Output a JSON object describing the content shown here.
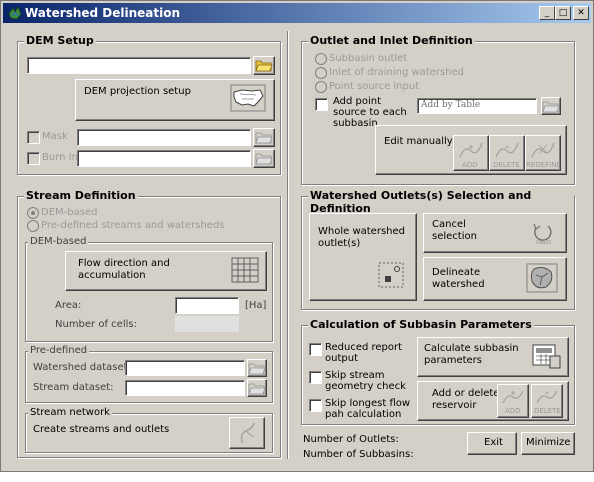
{
  "window": {
    "title": "Watershed Delineation",
    "minimize": "_",
    "restore": "□",
    "close": "✕"
  },
  "dem_setup": {
    "title": "DEM Setup",
    "projection_button": "DEM projection setup",
    "mask_label": "Mask",
    "burn_in_label": "Burn In"
  },
  "stream_definition": {
    "title": "Stream Definition",
    "option_dem": "DEM-based",
    "option_predefined": "Pre-defined streams and watersheds",
    "dem_group": "DEM-based",
    "flow_button": "Flow direction and accumulation",
    "area_label": "Area:",
    "area_unit": "[Ha]",
    "cells_label": "Number of cells:",
    "predefined_group": "Pre-defined",
    "watershed_dataset_label": "Watershed dataset:",
    "stream_dataset_label": "Stream dataset:",
    "stream_network_group": "Stream network",
    "create_streams_label": "Create streams and outlets"
  },
  "outlet_inlet": {
    "title": "Outlet and Inlet Definition",
    "option_subbasin_outlet": "Subbasin outlet",
    "option_inlet": "Inlet of draining watershed",
    "option_point_source": "Point source input",
    "add_point_source_label": "Add point source to each subbasin",
    "add_by_table_value": "Add by Table",
    "edit_manually": "Edit manually",
    "add_icon_label": "ADD",
    "delete_icon_label": "DELETE",
    "redefine_icon_label": "REDEFINE"
  },
  "outlets_selection": {
    "title": "Watershed Outlets(s) Selection and Definition",
    "whole_watershed": "Whole watershed outlet(s)",
    "cancel_selection": "Cancel selection",
    "delineate_watershed": "Delineate watershed",
    "undo_icon_label": "UNDO"
  },
  "subbasin_params": {
    "title": "Calculation of Subbasin Parameters",
    "reduced_report": "Reduced report output",
    "skip_stream_geometry": "Skip stream geometry check",
    "skip_longest_flow": "Skip longest flow pah calculation",
    "calculate_button": "Calculate subbasin parameters",
    "add_delete_reservoir": "Add or delete reservoir",
    "add_icon_label": "ADD",
    "delete_icon_label": "DELETE"
  },
  "footer": {
    "outlets_label": "Number of Outlets:",
    "subbasins_label": "Number of Subbasins:",
    "exit_button": "Exit",
    "minimize_button": "Minimize"
  }
}
